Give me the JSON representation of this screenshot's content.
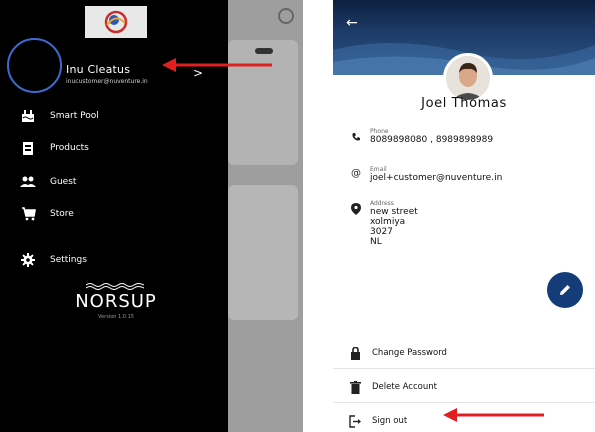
{
  "drawer": {
    "user_name": "Inu Cleatus",
    "user_email": "inucustomer@nuventure.in",
    "chevron": ">",
    "menu": [
      {
        "label": "Smart Pool",
        "icon": "pool-icon"
      },
      {
        "label": "Products",
        "icon": "products-icon"
      },
      {
        "label": "Guest",
        "icon": "guest-icon"
      },
      {
        "label": "Store",
        "icon": "cart-icon"
      },
      {
        "label": "Settings",
        "icon": "gear-icon"
      }
    ],
    "brand": "NORSUP",
    "version": "Version 1.0.15"
  },
  "profile": {
    "back": "←",
    "name": "Joel Thomas",
    "phone_label": "Phone",
    "phone": "8089898080 , 8989898989",
    "email_label": "Email",
    "email": "joel+customer@nuventure.in",
    "address_label": "Address",
    "address_lines": [
      "new street",
      "xolmiya",
      "3027",
      "NL"
    ],
    "actions": {
      "change_password": "Change Password",
      "delete_account": "Delete Account",
      "sign_out": "Sign out"
    }
  },
  "colors": {
    "drawer_bg": "#000000",
    "header_dark": "#0d2140",
    "fab": "#143c78",
    "annotation_arrow": "#e02020",
    "highlight_circle": "#3a6bd1"
  }
}
